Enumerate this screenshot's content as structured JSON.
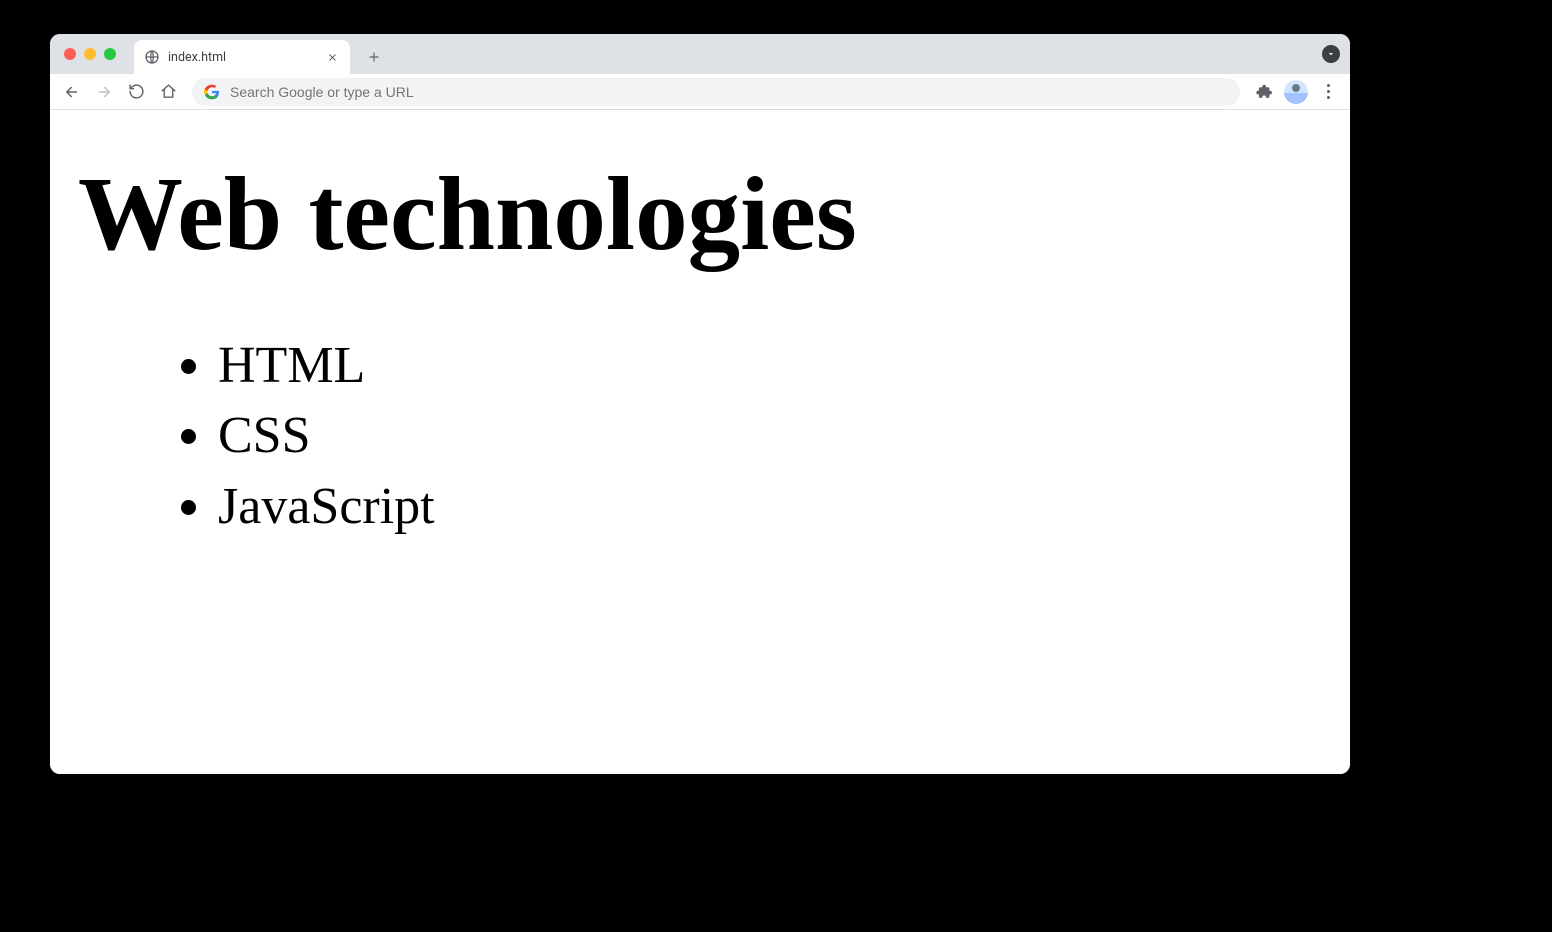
{
  "browser": {
    "tab_title": "index.html",
    "address_placeholder": "Search Google or type a URL"
  },
  "page": {
    "heading": "Web technologies",
    "items": [
      "HTML",
      "CSS",
      "JavaScript"
    ]
  }
}
